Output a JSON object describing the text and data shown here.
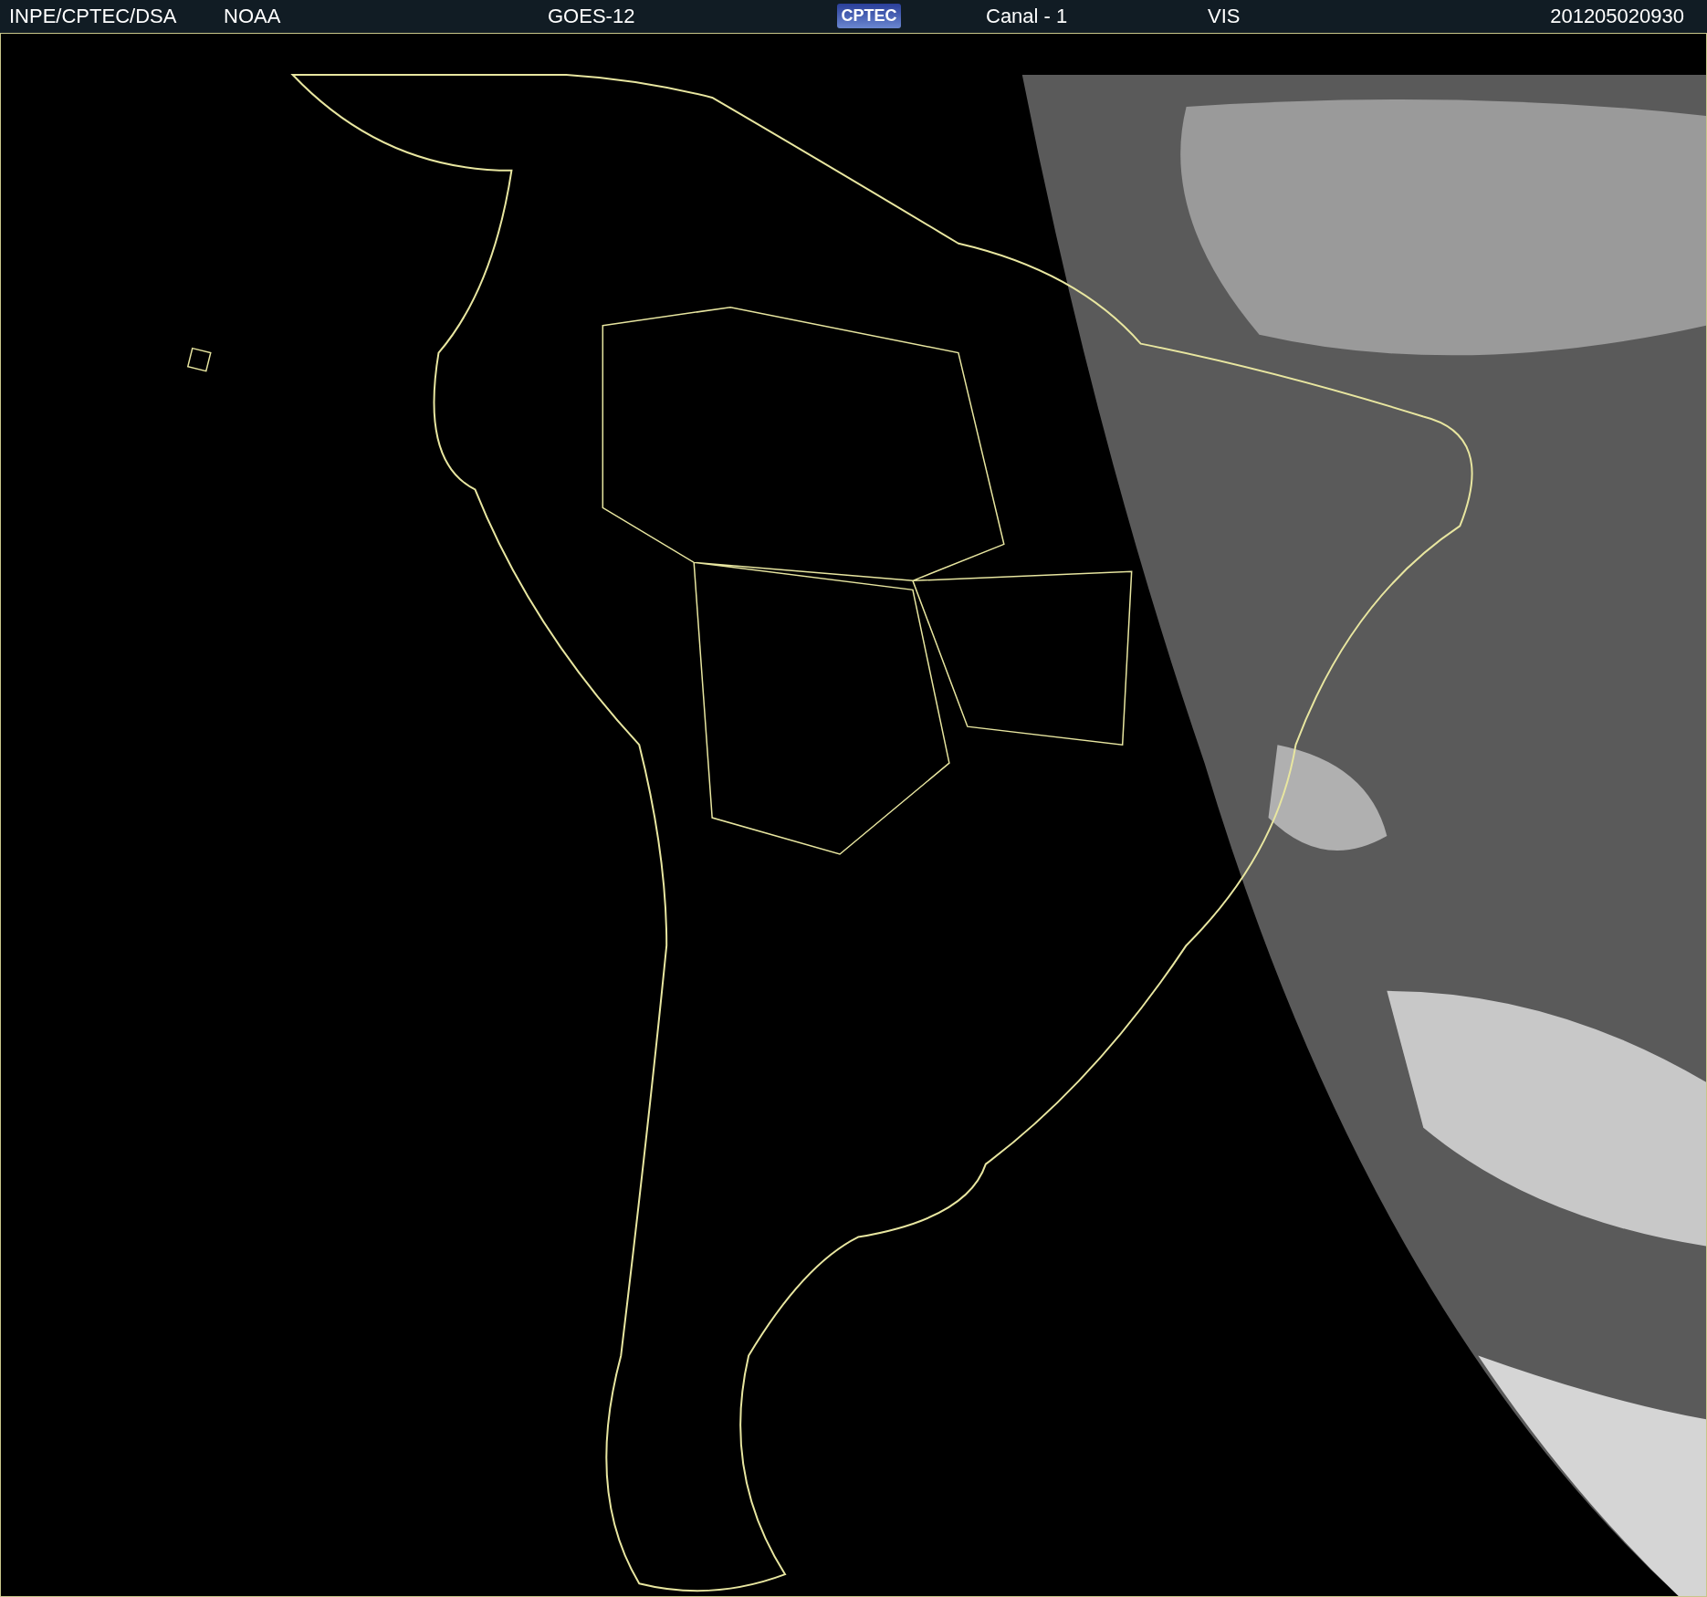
{
  "header": {
    "items": [
      {
        "kind": "text",
        "text": "INPE/CPTEC/DSA"
      },
      {
        "kind": "text",
        "text": "NOAA"
      },
      {
        "kind": "text",
        "text": "GOES-12"
      },
      {
        "kind": "logo",
        "text": "CPTEC"
      },
      {
        "kind": "text",
        "text": "Canal - 1"
      },
      {
        "kind": "text",
        "text": "VIS"
      },
      {
        "kind": "text",
        "text": "201205020930"
      }
    ]
  }
}
